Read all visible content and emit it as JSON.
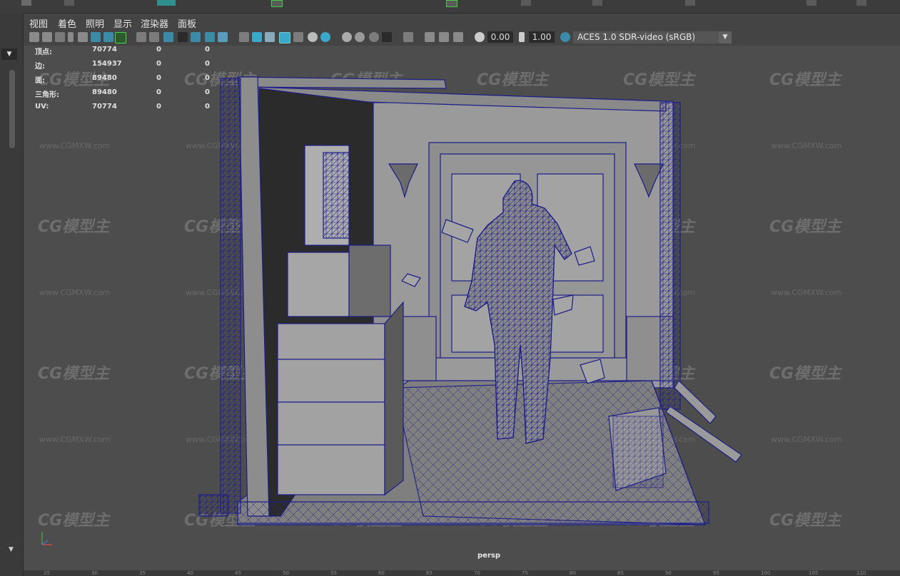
{
  "menu": [
    "视图",
    "着色",
    "照明",
    "显示",
    "渲染器",
    "面板"
  ],
  "toolbar": {
    "exposure": "0.00",
    "gamma": "1.00",
    "color_space": "ACES 1.0 SDR-video (sRGB)",
    "icons": [
      "select-camera-icon",
      "camera-attributes-icon",
      "bookmark-icon",
      "image-plane-icon",
      "grid-icon",
      "film-gate-icon",
      "resolution-gate-icon",
      "gate-mask-icon",
      "field-chart-icon",
      "safe-action-icon",
      "safe-title-icon",
      "wireframe-icon",
      "smooth-shade-icon",
      "default-material-icon",
      "wireframe-on-shaded-icon",
      "xray-icon",
      "use-all-lights-icon",
      "shadows-icon",
      "screen-space-ao-icon",
      "motion-blur-icon",
      "anti-aliasing-icon",
      "depth-of-field-icon",
      "isolate-select-icon",
      "xray-joints-icon",
      "xray-active-icon",
      "exposure-icon",
      "gamma-icon",
      "color-management-icon"
    ]
  },
  "stats": {
    "rows": [
      {
        "label": "顶点:",
        "v1": "70774",
        "v2": "0",
        "v3": "0"
      },
      {
        "label": "边:",
        "v1": "154937",
        "v2": "0",
        "v3": "0"
      },
      {
        "label": "面:",
        "v1": "89480",
        "v2": "0",
        "v3": "0"
      },
      {
        "label": "三角形:",
        "v1": "89480",
        "v2": "0",
        "v3": "0"
      },
      {
        "label": "UV:",
        "v1": "70774",
        "v2": "0",
        "v3": "0"
      }
    ]
  },
  "viewport": {
    "camera": "persp"
  },
  "watermark": {
    "logo": "CG模型主",
    "url": "www.CGMXW.com"
  },
  "ruler": [
    "25",
    "30",
    "35",
    "40",
    "45",
    "50",
    "55",
    "60",
    "65",
    "70",
    "75",
    "80",
    "85",
    "90",
    "95",
    "100",
    "105",
    "110"
  ],
  "colors": {
    "wire": "#1c1c8a",
    "viewport_bg": "#4d4d4d",
    "highlight": "#48d848"
  }
}
